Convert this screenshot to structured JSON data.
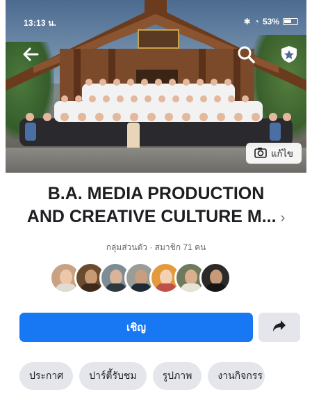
{
  "status_bar": {
    "time_left": "13:13 น.",
    "battery": "53%"
  },
  "cover": {
    "edit_label": "แก้ไข",
    "icons": [
      "back-arrow-icon",
      "search-icon",
      "shield-icon",
      "camera-icon"
    ]
  },
  "group": {
    "title_line1": "B.A. MEDIA PRODUCTION",
    "title_line2": "AND CREATIVE CULTURE M...",
    "meta": "กลุ่มส่วนตัว · สมาชิก 71 คน",
    "member_avatars": 7
  },
  "actions": {
    "invite_label": "เชิญ",
    "share_icon": "share-arrow-icon"
  },
  "tabs": [
    {
      "label": "ประกาศ"
    },
    {
      "label": "ปาร์ตี้รับชม"
    },
    {
      "label": "รูปภาพ"
    },
    {
      "label": "งานกิจกรร"
    }
  ],
  "colors": {
    "primary": "#1877f2",
    "secondary_bg": "#e4e6eb",
    "text": "#1c1e21",
    "muted": "#65676b"
  }
}
